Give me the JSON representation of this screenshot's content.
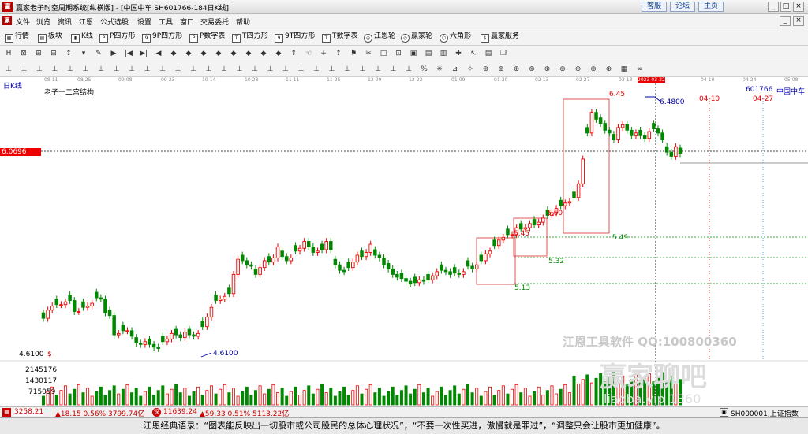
{
  "window": {
    "title": "赢家老子时空周期系统[纵横版] - [中国中车  SH601766-184日K线]",
    "links": [
      "客服",
      "论坛",
      "主页"
    ],
    "controls": [
      "_",
      "□",
      "×"
    ]
  },
  "menu": [
    "文件",
    "浏览",
    "资讯",
    "江恩",
    "公式选股",
    "设置",
    "工具",
    "窗口",
    "交易委托",
    "帮助"
  ],
  "toolbar2": [
    "行情",
    "板块",
    "K线",
    "P四方形",
    "9P四方形",
    "P数字表",
    "T四方形",
    "9T四方形",
    "T数字表",
    "江恩轮",
    "赢家轮",
    "六角形",
    "赢家服务"
  ],
  "ruler_dates": [
    "08-11",
    "08-25",
    "09-08",
    "09-23",
    "10-14",
    "10-28",
    "11-11",
    "11-25",
    "12-09",
    "12-23",
    "01-09",
    "01-30",
    "02-13",
    "02-27",
    "03-13",
    "2023-03-22",
    "04-10",
    "04-24",
    "05-08"
  ],
  "chart": {
    "period_label": "日K线",
    "structure_label": "老子十二宫结构",
    "stock_code": "601766",
    "stock_name": "中国中车",
    "price_tag": "6.0696",
    "low_axis_label": "4.6100",
    "low_marker": "$",
    "low_value_label": "4.6100",
    "high_value_label": "6.4800",
    "future_dates": [
      "04-10",
      "04-27"
    ],
    "box_levels": [
      "6.45",
      "5.60",
      "5.49",
      "5.45",
      "5.32",
      "5.13"
    ],
    "vol_ticks": [
      "2145176",
      "1430117",
      "715059"
    ],
    "watermark": [
      "江恩工具软件  QQ:100800360",
      "赢家聊吧",
      "liaoba.vip 1360"
    ]
  },
  "chart_data": {
    "type": "candlestick",
    "title": "老子十二宫结构",
    "series": [
      {
        "name": "中国中车",
        "values": [
          4.85,
          4.91,
          4.94,
          4.95,
          4.95,
          4.97,
          4.98,
          4.9,
          4.9,
          4.93,
          4.94,
          4.96,
          5.0,
          4.99,
          4.89,
          4.87,
          4.73,
          4.74,
          4.76,
          4.76,
          4.72,
          4.67,
          4.66,
          4.68,
          4.66,
          4.64,
          4.63,
          4.68,
          4.7,
          4.74,
          4.73,
          4.71,
          4.75,
          4.73,
          4.72,
          4.74,
          4.79,
          4.86,
          4.93,
          4.98,
          4.99,
          5.01,
          5.03,
          5.17,
          5.28,
          5.27,
          5.24,
          5.23,
          5.17,
          5.22,
          5.27,
          5.26,
          5.29,
          5.37,
          5.3,
          5.27,
          5.29,
          5.34,
          5.36,
          5.41,
          5.37,
          5.33,
          5.34,
          5.35,
          5.41,
          5.35,
          5.24,
          5.2,
          5.19,
          5.22,
          5.26,
          5.31,
          5.3,
          5.33,
          5.39,
          5.31,
          5.29,
          5.24,
          5.21,
          5.17,
          5.15,
          5.14,
          5.12,
          5.1,
          5.11,
          5.13,
          5.12,
          5.13,
          5.16,
          5.19,
          5.2,
          5.19,
          5.17,
          5.18,
          5.17,
          5.19,
          5.23,
          5.21,
          5.24,
          5.27,
          5.32,
          5.34,
          5.38,
          5.42,
          5.44,
          5.46,
          5.46,
          5.51,
          5.5,
          5.51,
          5.54,
          5.53,
          5.55,
          5.58,
          5.6,
          5.62,
          5.65,
          5.67,
          5.69,
          5.7,
          5.73,
          5.83,
          6.01,
          6.2,
          6.35,
          6.3,
          6.27,
          6.22,
          6.2,
          6.15,
          6.24,
          6.26,
          6.22,
          6.18,
          6.2,
          6.18,
          6.16,
          6.21,
          6.23,
          6.2,
          6.15,
          6.06,
          6.03,
          6.1,
          6.05
        ]
      }
    ],
    "price_range": [
      4.61,
      6.48
    ],
    "annotations": [
      "6.45",
      "5.60",
      "5.49",
      "5.45",
      "5.32",
      "5.13",
      "6.4800",
      "4.6100"
    ]
  },
  "status": {
    "index1": "3258.21",
    "index1_change": "▲18.15 0.56% 3799.74亿",
    "index2": "11639.24",
    "index2_change": "▲59.33 0.51% 5113.22亿",
    "right": "SH000001,上证指数"
  },
  "quote": "江恩经典语录：“图表能反映出一切股市或公司股民的总体心理状况”，“不要一次性买进，傲慢就是罪过”，“调整只会让股市更加健康”。"
}
